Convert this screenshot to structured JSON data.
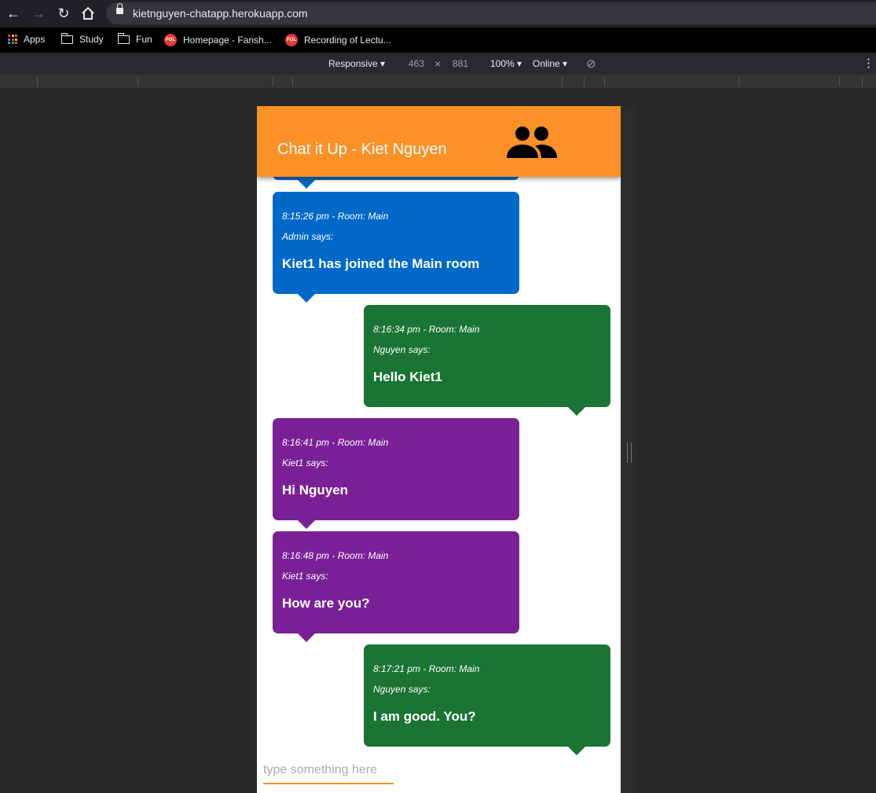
{
  "browser": {
    "url": "kietnguyen-chatapp.herokuapp.com",
    "bookmarks": [
      {
        "label": "Apps",
        "icon": "apps-grid-icon"
      },
      {
        "label": "Study",
        "icon": "folder-icon"
      },
      {
        "label": "Fun",
        "icon": "folder-icon"
      },
      {
        "label": "Homepage - Fansh...",
        "icon": "fol-logo-icon"
      },
      {
        "label": "Recording of Lectu...",
        "icon": "fol-logo-icon"
      }
    ],
    "fol_logo_text": "FOL"
  },
  "devtools": {
    "device": "Responsive",
    "width": "463",
    "times": "×",
    "height": "881",
    "zoom": "100%",
    "network": "Online"
  },
  "app": {
    "title": "Chat it Up - Kiet Nguyen",
    "header_icon": "people-icon",
    "colors": {
      "header": "#fb9127",
      "admin": "#0068c9",
      "self": "#1a7434",
      "other": "#7a2096"
    },
    "messages": [
      {
        "meta": "8:15:26 pm - Room: Main",
        "who": "Admin says:",
        "text": "Kiet1 has joined the Main room",
        "side": "left",
        "color": "blue"
      },
      {
        "meta": "8:16:34 pm - Room: Main",
        "who": "Nguyen says:",
        "text": "Hello Kiet1",
        "side": "right",
        "color": "green"
      },
      {
        "meta": "8:16:41 pm - Room: Main",
        "who": "Kiet1 says:",
        "text": "Hi Nguyen",
        "side": "left",
        "color": "purple"
      },
      {
        "meta": "8:16:48 pm - Room: Main",
        "who": "Kiet1 says:",
        "text": "How are you?",
        "side": "left",
        "color": "purple"
      },
      {
        "meta": "8:17:21 pm - Room: Main",
        "who": "Nguyen says:",
        "text": "I am good. You?",
        "side": "right",
        "color": "green"
      }
    ],
    "input": {
      "placeholder": "type something here",
      "value": ""
    }
  }
}
